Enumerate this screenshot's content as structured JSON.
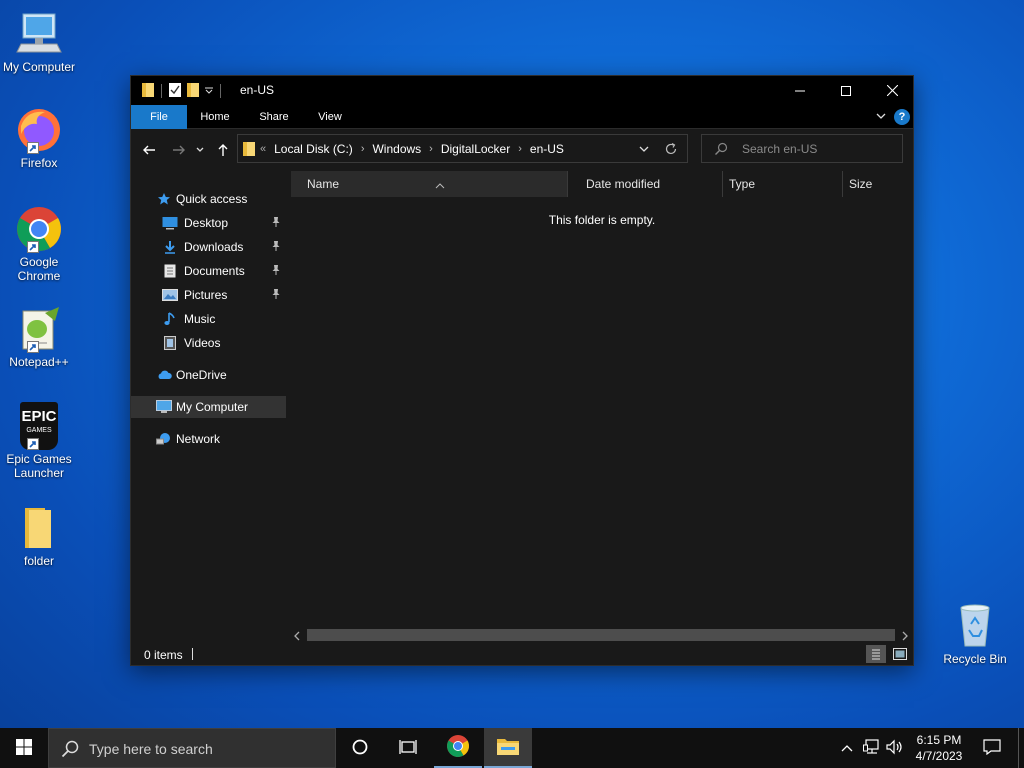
{
  "desktop": {
    "icons": [
      {
        "label": "My Computer"
      },
      {
        "label": "Firefox"
      },
      {
        "label": "Google Chrome"
      },
      {
        "label": "Notepad++"
      },
      {
        "label": "Epic Games Launcher"
      },
      {
        "label": "folder"
      }
    ],
    "recycle_bin": "Recycle Bin",
    "epic_logo_text": "EPIC",
    "epic_logo_sub": "GAMES"
  },
  "window": {
    "title": "en-US",
    "ribbon_tabs": {
      "file": "File",
      "home": "Home",
      "share": "Share",
      "view": "View"
    },
    "help": "?",
    "address": {
      "lead": "«",
      "crumbs": [
        "Local Disk (C:)",
        "Windows",
        "DigitalLocker",
        "en-US"
      ],
      "separator": "›"
    },
    "search": {
      "placeholder": "Search en-US"
    },
    "nav": {
      "quick_access": "Quick access",
      "desktop": "Desktop",
      "downloads": "Downloads",
      "documents": "Documents",
      "pictures": "Pictures",
      "music": "Music",
      "videos": "Videos",
      "onedrive": "OneDrive",
      "my_computer": "My Computer",
      "network": "Network"
    },
    "columns": {
      "name": "Name",
      "date": "Date modified",
      "type": "Type",
      "size": "Size"
    },
    "empty_message": "This folder is empty.",
    "status": {
      "items": "0 items"
    }
  },
  "taskbar": {
    "search_placeholder": "Type here to search",
    "time": "6:15 PM",
    "date": "4/7/2023"
  },
  "colors": {
    "accent": "#1979ca",
    "window_bg": "#191919",
    "titlebar_bg": "#000000",
    "taskbar_bg": "#101010"
  }
}
